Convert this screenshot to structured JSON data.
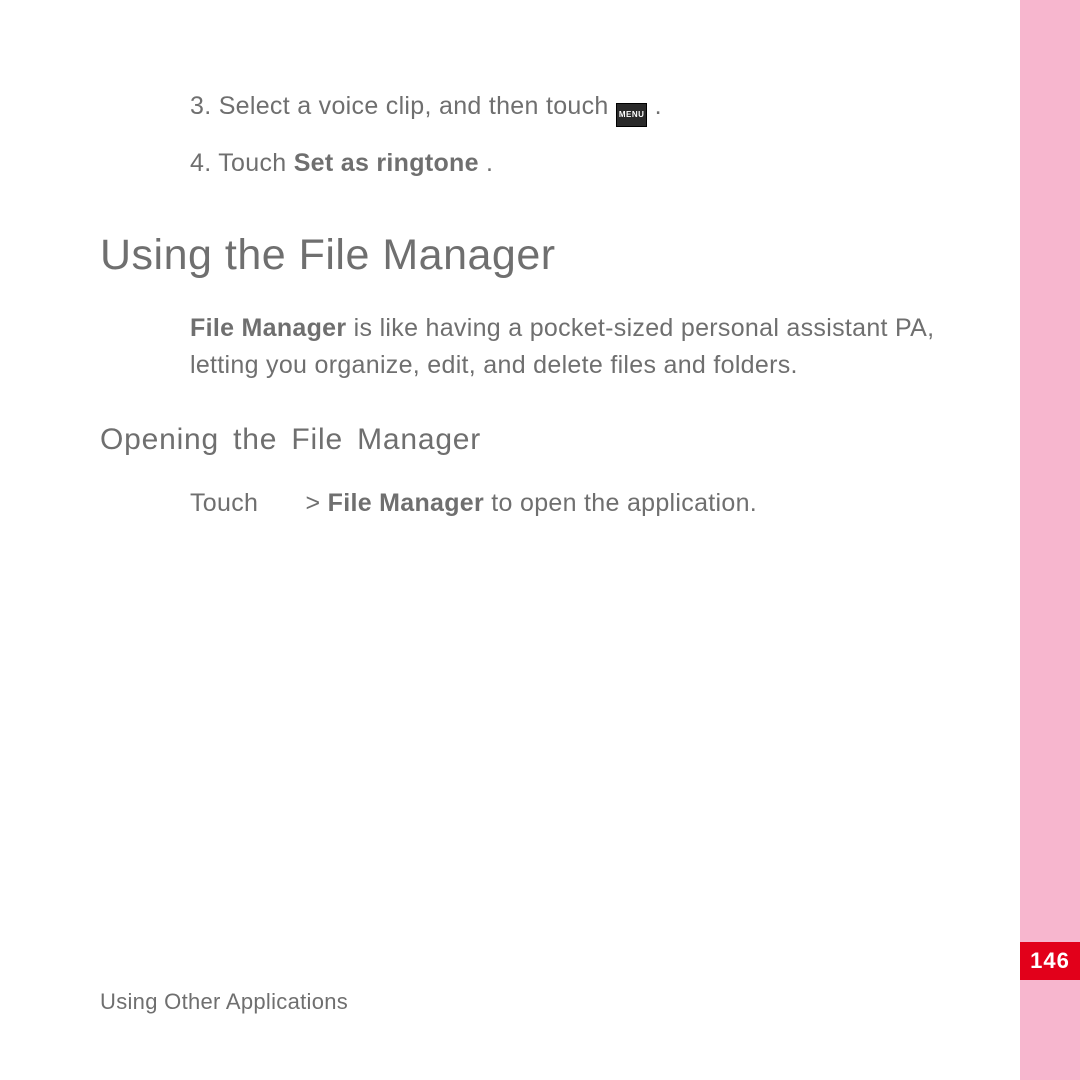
{
  "steps": {
    "s3_pre": "3. Select a voice clip, and then touch ",
    "s3_icon": "MENU",
    "s3_post": ".",
    "s4_pre": "4. Touch ",
    "s4_bold": "Set as ringtone",
    "s4_post": "."
  },
  "heading1": "Using the File Manager",
  "para1_bold": "File Manager",
  "para1_rest": " is like having a pocket-sized personal assistant PA, letting you organize, edit, and delete files and folders.",
  "heading2": "Opening the File Manager",
  "para2_pre": "Touch",
  "para2_sep": " > ",
  "para2_bold": "File Manager",
  "para2_post": " to open the application.",
  "footer": "Using Other Applications",
  "page_number": "146"
}
